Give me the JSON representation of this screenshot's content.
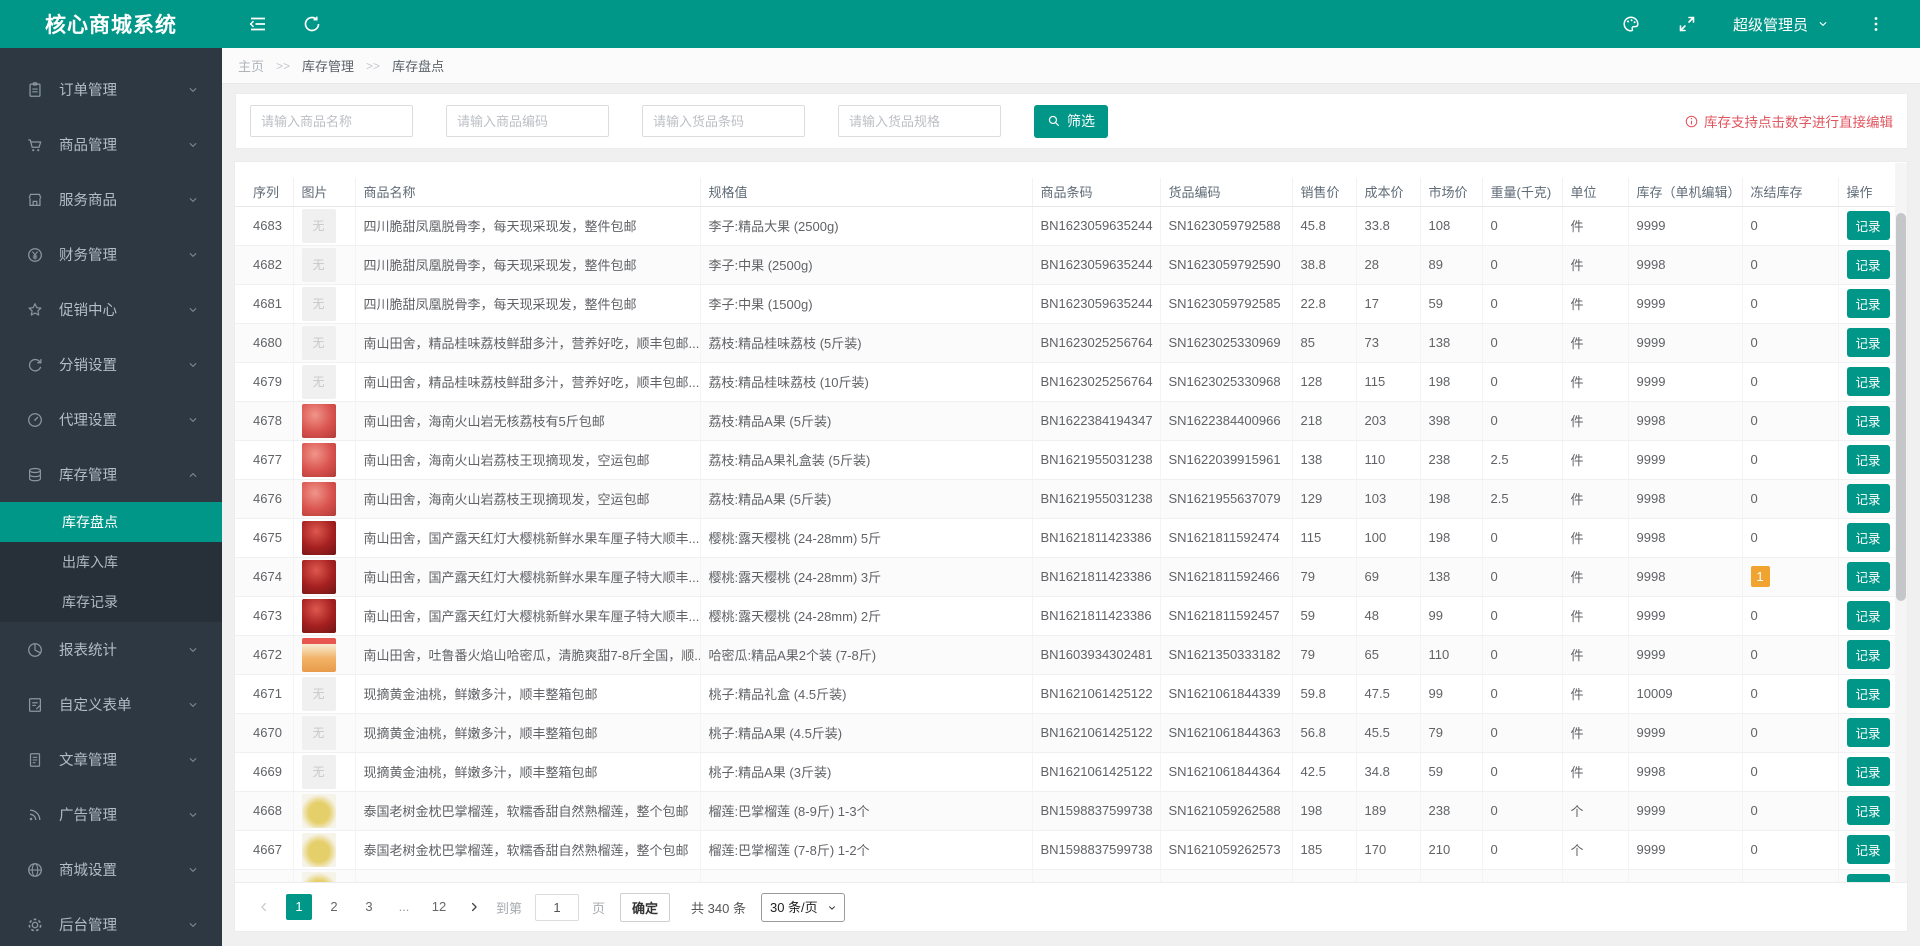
{
  "app": {
    "title": "核心商城系统"
  },
  "topbar": {
    "user": "超级管理员"
  },
  "colors": {
    "accent": "#009688",
    "sidebar_bg": "#2e3843",
    "hint_red": "#e0565f",
    "frozen_badge": "#f0a32e"
  },
  "sidebar": {
    "items": [
      {
        "label": "订单管理"
      },
      {
        "label": "商品管理"
      },
      {
        "label": "服务商品"
      },
      {
        "label": "财务管理"
      },
      {
        "label": "促销中心"
      },
      {
        "label": "分销设置"
      },
      {
        "label": "代理设置"
      },
      {
        "label": "库存管理"
      },
      {
        "label": "报表统计"
      },
      {
        "label": "自定义表单"
      },
      {
        "label": "文章管理"
      },
      {
        "label": "广告管理"
      },
      {
        "label": "商城设置"
      },
      {
        "label": "后台管理"
      }
    ],
    "submenu": [
      {
        "label": "库存盘点",
        "active": true
      },
      {
        "label": "出库入库",
        "active": false
      },
      {
        "label": "库存记录",
        "active": false
      }
    ]
  },
  "breadcrumb": {
    "home": "主页",
    "sep": ">>",
    "section": "库存管理",
    "current": "库存盘点"
  },
  "filters": {
    "placeholders": [
      "请输入商品名称",
      "请输入商品编码",
      "请输入货品条码",
      "请输入货品规格"
    ],
    "filter_button": "筛选",
    "hint": "库存支持点击数字进行直接编辑"
  },
  "table": {
    "columns": [
      "序列",
      "图片",
      "商品名称",
      "规格值",
      "商品条码",
      "货品编码",
      "销售价",
      "成本价",
      "市场价",
      "重量(千克)",
      "单位",
      "库存（单机编辑）",
      "冻结库存",
      "操作"
    ],
    "no_image_label": "无",
    "action_label": "记录",
    "rows": [
      {
        "seq": "4683",
        "img": "none",
        "name": "四川脆甜凤凰脱骨李，每天现采现发，整件包邮",
        "spec": "李子:精品大果 (2500g)",
        "barcode": "BN1623059635244",
        "sku": "SN1623059792588",
        "sale": "45.8",
        "cost": "33.8",
        "market": "108",
        "weight": "0",
        "unit": "件",
        "stock": "9999",
        "frozen": "0"
      },
      {
        "seq": "4682",
        "img": "none",
        "name": "四川脆甜凤凰脱骨李，每天现采现发，整件包邮",
        "spec": "李子:中果 (2500g)",
        "barcode": "BN1623059635244",
        "sku": "SN1623059792590",
        "sale": "38.8",
        "cost": "28",
        "market": "89",
        "weight": "0",
        "unit": "件",
        "stock": "9998",
        "frozen": "0"
      },
      {
        "seq": "4681",
        "img": "none",
        "name": "四川脆甜凤凰脱骨李，每天现采现发，整件包邮",
        "spec": "李子:中果 (1500g)",
        "barcode": "BN1623059635244",
        "sku": "SN1623059792585",
        "sale": "22.8",
        "cost": "17",
        "market": "59",
        "weight": "0",
        "unit": "件",
        "stock": "9999",
        "frozen": "0"
      },
      {
        "seq": "4680",
        "img": "none",
        "name": "南山田舍，精品桂味荔枝鲜甜多汁，营养好吃，顺丰包邮...",
        "spec": "荔枝:精品桂味荔枝 (5斤装)",
        "barcode": "BN1623025256764",
        "sku": "SN1623025330969",
        "sale": "85",
        "cost": "73",
        "market": "138",
        "weight": "0",
        "unit": "件",
        "stock": "9999",
        "frozen": "0"
      },
      {
        "seq": "4679",
        "img": "none",
        "name": "南山田舍，精品桂味荔枝鲜甜多汁，营养好吃，顺丰包邮...",
        "spec": "荔枝:精品桂味荔枝 (10斤装)",
        "barcode": "BN1623025256764",
        "sku": "SN1623025330968",
        "sale": "128",
        "cost": "115",
        "market": "198",
        "weight": "0",
        "unit": "件",
        "stock": "9999",
        "frozen": "0"
      },
      {
        "seq": "4678",
        "img": "lychee",
        "name": "南山田舍，海南火山岩无核荔枝有5斤包邮",
        "spec": "荔枝:精品A果 (5斤装)",
        "barcode": "BN1622384194347",
        "sku": "SN1622384400966",
        "sale": "218",
        "cost": "203",
        "market": "398",
        "weight": "0",
        "unit": "件",
        "stock": "9998",
        "frozen": "0"
      },
      {
        "seq": "4677",
        "img": "lychee",
        "name": "南山田舍，海南火山岩荔枝王现摘现发，空运包邮",
        "spec": "荔枝:精品A果礼盒装 (5斤装)",
        "barcode": "BN1621955031238",
        "sku": "SN1622039915961",
        "sale": "138",
        "cost": "110",
        "market": "238",
        "weight": "2.5",
        "unit": "件",
        "stock": "9999",
        "frozen": "0"
      },
      {
        "seq": "4676",
        "img": "lychee",
        "name": "南山田舍，海南火山岩荔枝王现摘现发，空运包邮",
        "spec": "荔枝:精品A果 (5斤装)",
        "barcode": "BN1621955031238",
        "sku": "SN1621955637079",
        "sale": "129",
        "cost": "103",
        "market": "198",
        "weight": "2.5",
        "unit": "件",
        "stock": "9998",
        "frozen": "0"
      },
      {
        "seq": "4675",
        "img": "cherry",
        "name": "南山田舍，国产露天红灯大樱桃新鲜水果车厘子特大顺丰...",
        "spec": "樱桃:露天樱桃 (24-28mm) 5斤",
        "barcode": "BN1621811423386",
        "sku": "SN1621811592474",
        "sale": "115",
        "cost": "100",
        "market": "198",
        "weight": "0",
        "unit": "件",
        "stock": "9998",
        "frozen": "0"
      },
      {
        "seq": "4674",
        "img": "cherry",
        "name": "南山田舍，国产露天红灯大樱桃新鲜水果车厘子特大顺丰...",
        "spec": "樱桃:露天樱桃 (24-28mm) 3斤",
        "barcode": "BN1621811423386",
        "sku": "SN1621811592466",
        "sale": "79",
        "cost": "69",
        "market": "138",
        "weight": "0",
        "unit": "件",
        "stock": "9998",
        "frozen": "1",
        "frozen_highlight": true
      },
      {
        "seq": "4673",
        "img": "cherry",
        "name": "南山田舍，国产露天红灯大樱桃新鲜水果车厘子特大顺丰...",
        "spec": "樱桃:露天樱桃 (24-28mm) 2斤",
        "barcode": "BN1621811423386",
        "sku": "SN1621811592457",
        "sale": "59",
        "cost": "48",
        "market": "99",
        "weight": "0",
        "unit": "件",
        "stock": "9999",
        "frozen": "0"
      },
      {
        "seq": "4672",
        "img": "melon",
        "name": "南山田舍，吐鲁番火焰山哈密瓜，清脆爽甜7-8斤全国，顺...",
        "spec": "哈密瓜:精品A果2个装 (7-8斤)",
        "barcode": "BN1603934302481",
        "sku": "SN1621350333182",
        "sale": "79",
        "cost": "65",
        "market": "110",
        "weight": "0",
        "unit": "件",
        "stock": "9999",
        "frozen": "0"
      },
      {
        "seq": "4671",
        "img": "none",
        "name": "现摘黄金油桃，鲜嫩多汁，顺丰整箱包邮",
        "spec": "桃子:精品礼盒 (4.5斤装)",
        "barcode": "BN1621061425122",
        "sku": "SN1621061844339",
        "sale": "59.8",
        "cost": "47.5",
        "market": "99",
        "weight": "0",
        "unit": "件",
        "stock": "10009",
        "frozen": "0"
      },
      {
        "seq": "4670",
        "img": "none",
        "name": "现摘黄金油桃，鲜嫩多汁，顺丰整箱包邮",
        "spec": "桃子:精品A果 (4.5斤装)",
        "barcode": "BN1621061425122",
        "sku": "SN1621061844363",
        "sale": "56.8",
        "cost": "45.5",
        "market": "79",
        "weight": "0",
        "unit": "件",
        "stock": "9999",
        "frozen": "0"
      },
      {
        "seq": "4669",
        "img": "none",
        "name": "现摘黄金油桃，鲜嫩多汁，顺丰整箱包邮",
        "spec": "桃子:精品A果 (3斤装)",
        "barcode": "BN1621061425122",
        "sku": "SN1621061844364",
        "sale": "42.5",
        "cost": "34.8",
        "market": "59",
        "weight": "0",
        "unit": "件",
        "stock": "9998",
        "frozen": "0"
      },
      {
        "seq": "4668",
        "img": "durian",
        "name": "泰国老树金枕巴掌榴莲，软糯香甜自然熟榴莲，整个包邮",
        "spec": "榴莲:巴掌榴莲 (8-9斤) 1-3个",
        "barcode": "BN1598837599738",
        "sku": "SN1621059262588",
        "sale": "198",
        "cost": "189",
        "market": "238",
        "weight": "0",
        "unit": "个",
        "stock": "9999",
        "frozen": "0"
      },
      {
        "seq": "4667",
        "img": "durian",
        "name": "泰国老树金枕巴掌榴莲，软糯香甜自然熟榴莲，整个包邮",
        "spec": "榴莲:巴掌榴莲 (7-8斤) 1-2个",
        "barcode": "BN1598837599738",
        "sku": "SN1621059262573",
        "sale": "185",
        "cost": "170",
        "market": "210",
        "weight": "0",
        "unit": "个",
        "stock": "9999",
        "frozen": "0"
      },
      {
        "seq": "",
        "img": "durian",
        "name": "",
        "spec": "",
        "barcode": "",
        "sku": "",
        "sale": "",
        "cost": "",
        "market": "",
        "weight": "",
        "unit": "",
        "stock": "",
        "frozen": "",
        "partial": true
      }
    ]
  },
  "pagination": {
    "pages": [
      "1",
      "2",
      "3",
      "...",
      "12"
    ],
    "goto_label": "到第",
    "goto_value": "1",
    "page_unit": "页",
    "confirm_label": "确定",
    "total_label": "共 340 条",
    "page_size": "30 条/页"
  }
}
